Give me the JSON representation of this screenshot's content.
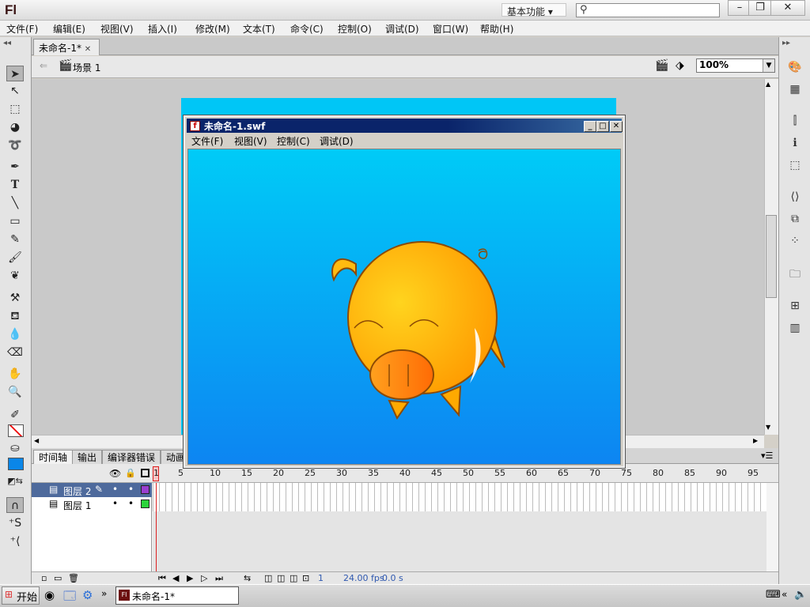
{
  "app": {
    "logo": "Fl",
    "workspace": "基本功能"
  },
  "window_controls": {
    "minimize": "–",
    "restore": "❐",
    "close": "✕"
  },
  "menubar": [
    "文件(F)",
    "编辑(E)",
    "视图(V)",
    "插入(I)",
    "修改(M)",
    "文本(T)",
    "命令(C)",
    "控制(O)",
    "调试(D)",
    "窗口(W)",
    "帮助(H)"
  ],
  "document": {
    "tab_label": "未命名-1*",
    "scene_label": "场景 1",
    "zoom": "100%"
  },
  "stage_color": "#00c6f6",
  "panel_tabs": [
    "时间轴",
    "输出",
    "编译器错误",
    "动画"
  ],
  "timeline": {
    "ruler": [
      "1",
      "5",
      "10",
      "15",
      "20",
      "25",
      "30",
      "35",
      "40",
      "45",
      "50",
      "55",
      "60",
      "65",
      "70",
      "75",
      "80",
      "85",
      "90",
      "95"
    ],
    "layers": [
      {
        "name": "图层 2",
        "selected": true,
        "color": "#9a3ed0"
      },
      {
        "name": "图层 1",
        "selected": false,
        "color": "#2bd33b"
      }
    ],
    "current_frame": "1",
    "fps": "24.00 fps",
    "time": "0.0 s"
  },
  "swf_window": {
    "title": "未命名-1.swf",
    "menu": [
      "文件(F)",
      "视图(V)",
      "控制(C)",
      "调试(D)"
    ]
  },
  "taskbar": {
    "start": "开始",
    "task": "未命名-1*",
    "arrows": "»"
  }
}
